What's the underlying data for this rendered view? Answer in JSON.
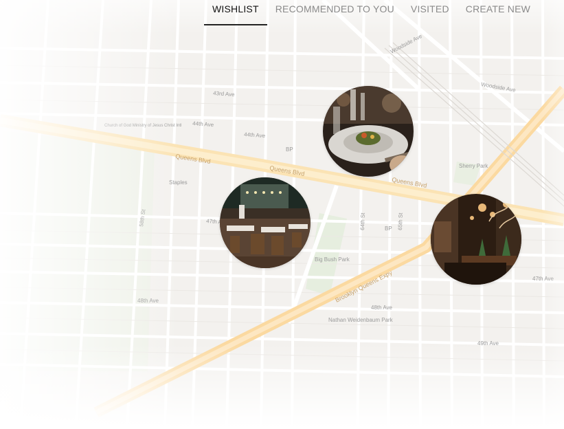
{
  "tabs": [
    {
      "label": "WISHLIST",
      "active": true
    },
    {
      "label": "RECOMMENDED TO YOU",
      "active": false
    },
    {
      "label": "VISITED",
      "active": false
    },
    {
      "label": "CREATE NEW",
      "active": false
    }
  ],
  "map": {
    "labels": {
      "queens_blvd": "Queens Blvd",
      "brooklyn_queens_expy": "Brooklyn Queens Expy",
      "woodside_ave": "Woodside Ave",
      "ave_47th": "47th Ave",
      "ave_48th": "48th Ave",
      "ave_49th": "49th Ave",
      "ave_44th": "44th Ave",
      "ave_43rd": "43rd Ave",
      "st_58th": "58th St",
      "st_65th": "65th St",
      "st_64th": "64th St",
      "big_bush_park": "Big Bush Park",
      "nathan_weidenbaum_park": "Nathan Weidenbaum Park",
      "sherry_park": "Sherry Park",
      "staples": "Staples",
      "bp": "BP",
      "church": "Church of God Ministry of Jesus Christ Intl"
    }
  },
  "pins": [
    {
      "name": "plated-dish-restaurant",
      "colors": {
        "bg": "#2a211b",
        "plate": "#d9d6d1"
      }
    },
    {
      "name": "dining-room-restaurant",
      "colors": {
        "bg": "#3a2f25",
        "wood": "#6b4a2c"
      }
    },
    {
      "name": "lounge-restaurant",
      "colors": {
        "bg": "#2c1d12",
        "glow": "#e8b878"
      }
    }
  ]
}
